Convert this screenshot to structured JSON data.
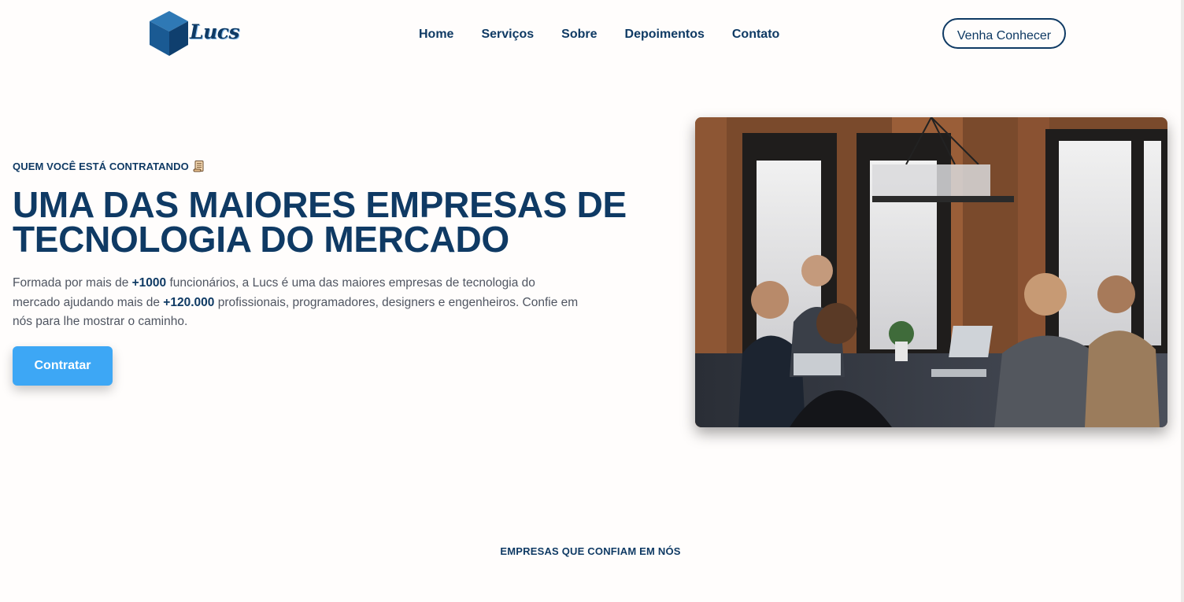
{
  "brand": {
    "name": "Lucs",
    "primary_color": "#0f3a64",
    "accent_color": "#3da7f5"
  },
  "nav": {
    "items": [
      {
        "label": "Home"
      },
      {
        "label": "Serviços"
      },
      {
        "label": "Sobre"
      },
      {
        "label": "Depoimentos"
      },
      {
        "label": "Contato"
      }
    ],
    "cta_label": "Venha Conhecer"
  },
  "hero": {
    "eyebrow": "QUEM VOCÊ ESTÁ CONTRATANDO",
    "eyebrow_icon": "scroll-icon",
    "title_line1": "UMA DAS MAIORES EMPRESAS DE",
    "title_line2": "TECNOLOGIA DO MERCADO",
    "text": {
      "part1": "Formada por mais de ",
      "bold1": "+1000",
      "part2": " funcionários, a Lucs é uma das maiores empresas de tecnologia do mercado ajudando mais de ",
      "bold2": "+120.000",
      "part3": " profissionais, programadores, designers e engenheiros. Confie em nós para lhe mostrar o caminho."
    },
    "button_label": "Contratar",
    "image_icon": "team-meeting-photo"
  },
  "trust": {
    "title": "EMPRESAS QUE CONFIAM EM NÓS"
  }
}
